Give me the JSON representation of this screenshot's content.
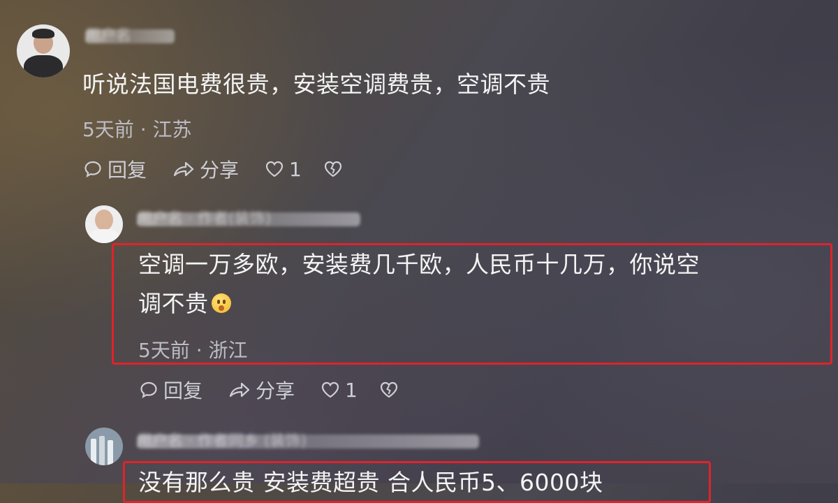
{
  "comments": [
    {
      "username": "用户名",
      "text": "听说法国电费很贵，安装空调费贵，空调不贵",
      "meta": "5天前 · 江苏",
      "reply_label": "回复",
      "share_label": "分享",
      "like_count": "1"
    },
    {
      "username": "用户名 · 作者(装饰)",
      "text_line1": "空调一万多欧，安装费几千欧，人民币十几万，你说空",
      "text_line2": "调不贵",
      "meta": "5天前 · 浙江",
      "reply_label": "回复",
      "share_label": "分享",
      "like_count": "1"
    },
    {
      "username": "用户名 · 作者同乡 (装饰)",
      "text": "没有那么贵 安装费超贵 合人民币5、6000块"
    }
  ],
  "colors": {
    "highlight": "#e0232a",
    "text": "#f4f4f4",
    "meta": "#bdbcc4"
  }
}
